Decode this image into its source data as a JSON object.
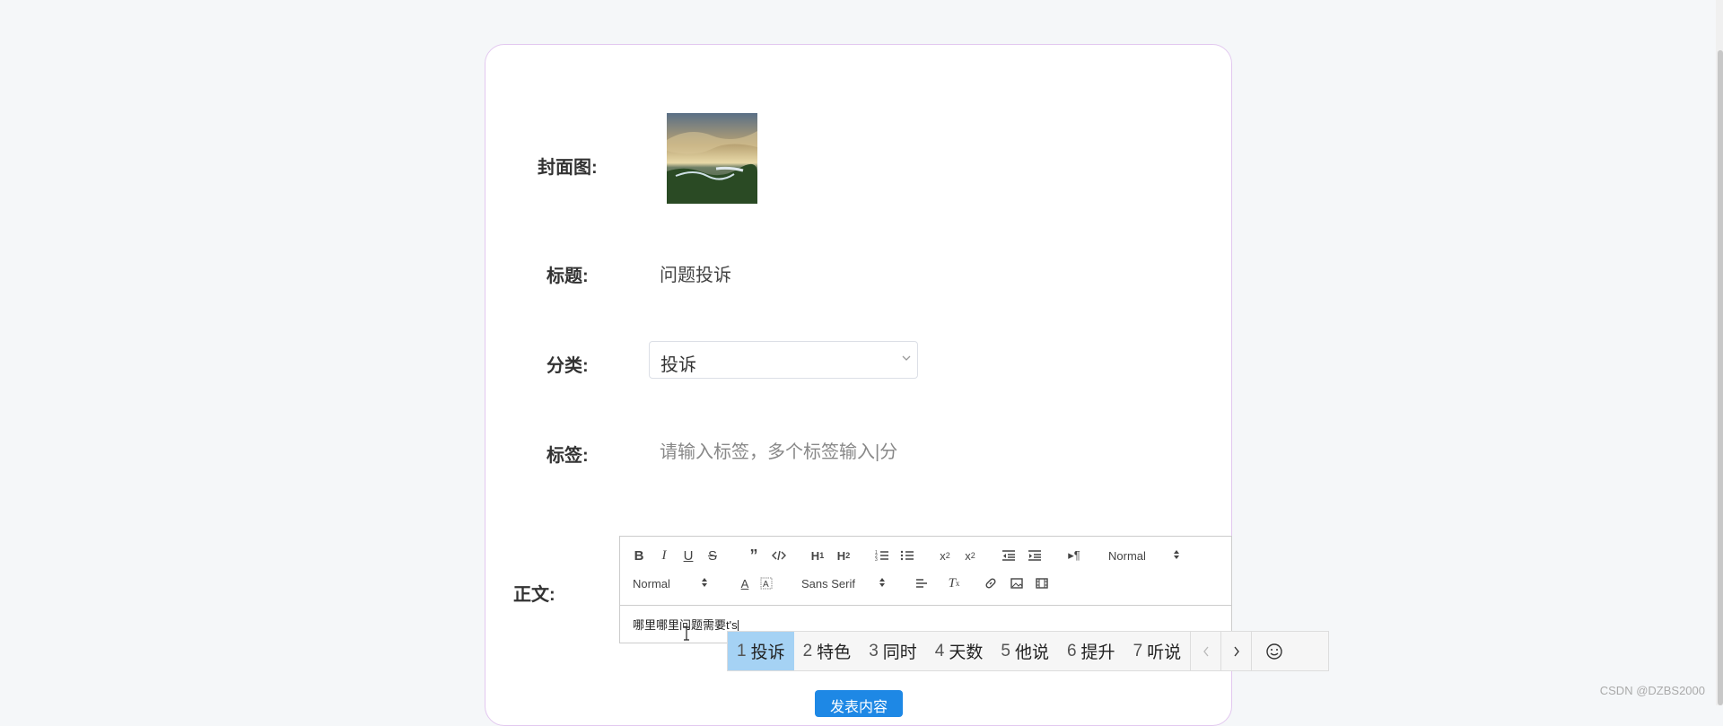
{
  "form": {
    "cover_label": "封面图:",
    "title_label": "标题:",
    "title_value": "问题投诉",
    "category_label": "分类:",
    "category_value": "投诉",
    "tags_label": "标签:",
    "tags_placeholder": "请输入标签，多个标签输入|分隔",
    "body_label": "正文:"
  },
  "editor": {
    "header_picker": "Normal",
    "size_picker": "Normal",
    "font_picker": "Sans Serif",
    "content": "哪里哪里问题需要t's"
  },
  "ime": {
    "candidates": [
      {
        "num": "1",
        "text": "投诉"
      },
      {
        "num": "2",
        "text": "特色"
      },
      {
        "num": "3",
        "text": "同时"
      },
      {
        "num": "4",
        "text": "天数"
      },
      {
        "num": "5",
        "text": "他说"
      },
      {
        "num": "6",
        "text": "提升"
      },
      {
        "num": "7",
        "text": "听说"
      }
    ]
  },
  "submit_label": "发表内容",
  "watermark": "CSDN @DZBS2000",
  "colors": {
    "accent": "#1e88e5",
    "card_border": "#e2c8ef",
    "ime_highlight": "#a5d2f4"
  }
}
